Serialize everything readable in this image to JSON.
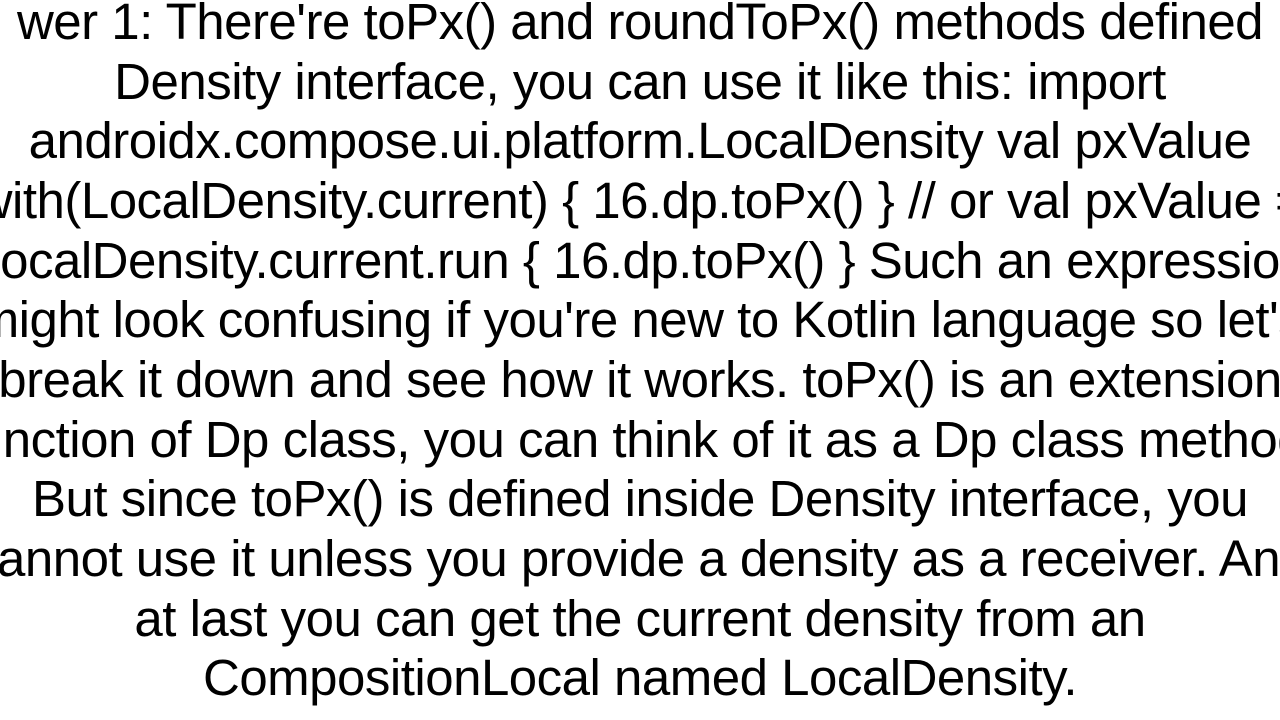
{
  "answer": {
    "text": "wer 1: There're toPx() and roundToPx() methods defined Density interface, you can use it like this: import androidx.compose.ui.platform.LocalDensity  val pxValue with(LocalDensity.current) { 16.dp.toPx() }  // or  val pxValue = LocalDensity.current.run { 16.dp.toPx() }   Such an expression might look confusing if you're new to Kotlin language so let's break it down and see how it works. toPx() is an extension function of Dp class, you can think of it as a Dp class method. But since toPx() is defined inside Density interface, you cannot use it unless you provide a density as a receiver. And at last you can get the current density from an CompositionLocal named LocalDensity."
  }
}
